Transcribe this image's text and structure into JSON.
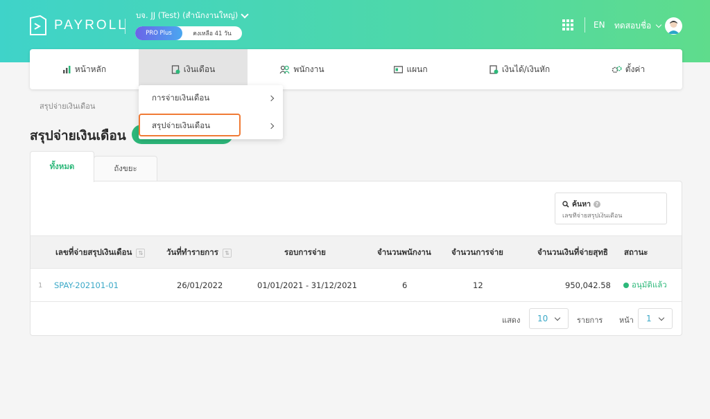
{
  "brand": {
    "name": "PAYROLL"
  },
  "company": {
    "name": "บจ. JJ (Test) (สำนักงานใหญ่)",
    "plan": "PRO Plus",
    "remaining": "คงเหลือ 41 วัน"
  },
  "header": {
    "lang": "EN",
    "user_name": "ทดสอบชื่อ"
  },
  "nav": {
    "items": [
      {
        "label": "หน้าหลัก"
      },
      {
        "label": "เงินเดือน"
      },
      {
        "label": "พนักงาน"
      },
      {
        "label": "แผนก"
      },
      {
        "label": "เงินได้/เงินหัก"
      },
      {
        "label": "ตั้งค่า"
      }
    ]
  },
  "dropdown": {
    "items": [
      {
        "label": "การจ่ายเงินเดือน"
      },
      {
        "label": "สรุปจ่ายเงินเดือน"
      }
    ]
  },
  "breadcrumb": "สรุปจ่ายเงินเดือน",
  "page_title": "สรุปจ่ายเงินเดือน",
  "tabs": [
    {
      "label": "ทั้งหมด"
    },
    {
      "label": "ถังขยะ"
    }
  ],
  "search": {
    "label": "ค้นหา",
    "placeholder": "เลขที่จ่ายสรุปเงินเดือน"
  },
  "table": {
    "headers": [
      "เลขที่จ่ายสรุปเงินเดือน",
      "วันที่ทำรายการ",
      "รอบการจ่าย",
      "จำนวนพนักงาน",
      "จำนวนการจ่าย",
      "จำนวนเงินที่จ่ายสุทธิ",
      "สถานะ"
    ],
    "rows": [
      {
        "index": "1",
        "number": "SPAY-202101-01",
        "date": "26/01/2022",
        "period": "01/01/2021 - 31/12/2021",
        "employees": "6",
        "payments": "12",
        "net": "950,042.58",
        "status": "อนุมัติแล้ว"
      }
    ]
  },
  "pagination": {
    "show_label": "แสดง",
    "page_size": "10",
    "items_label": "รายการ",
    "page_label": "หน้า",
    "page": "1"
  },
  "colors": {
    "accent": "#2db87a",
    "link": "#3aa8c7",
    "highlight": "#f07a34"
  }
}
